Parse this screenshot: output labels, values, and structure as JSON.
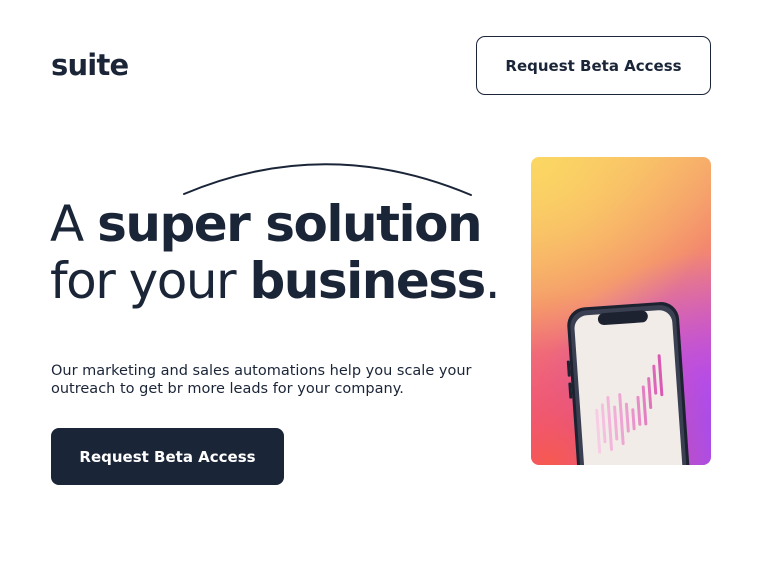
{
  "header": {
    "logo": "suite",
    "cta_label": "Request Beta Access"
  },
  "hero": {
    "headline": {
      "line1_light": "A ",
      "line1_bold": "super solution",
      "line2_light": "for your ",
      "line2_bold": "business",
      "line2_end": "."
    },
    "description": "Our marketing and sales automations help you scale your outreach to get br more leads for your company.",
    "cta_label": "Request Beta Access"
  },
  "colors": {
    "text": "#1b2538",
    "button_bg": "#1b2538",
    "button_text": "#ffffff",
    "gradient": [
      "#fbd763",
      "#f38a6d",
      "#e050c4",
      "#a64cf0"
    ]
  },
  "icons": {
    "decorative_arc": "arc-decoration",
    "phone": "phone-illustration",
    "chart_bars": "bar-chart-icon"
  }
}
